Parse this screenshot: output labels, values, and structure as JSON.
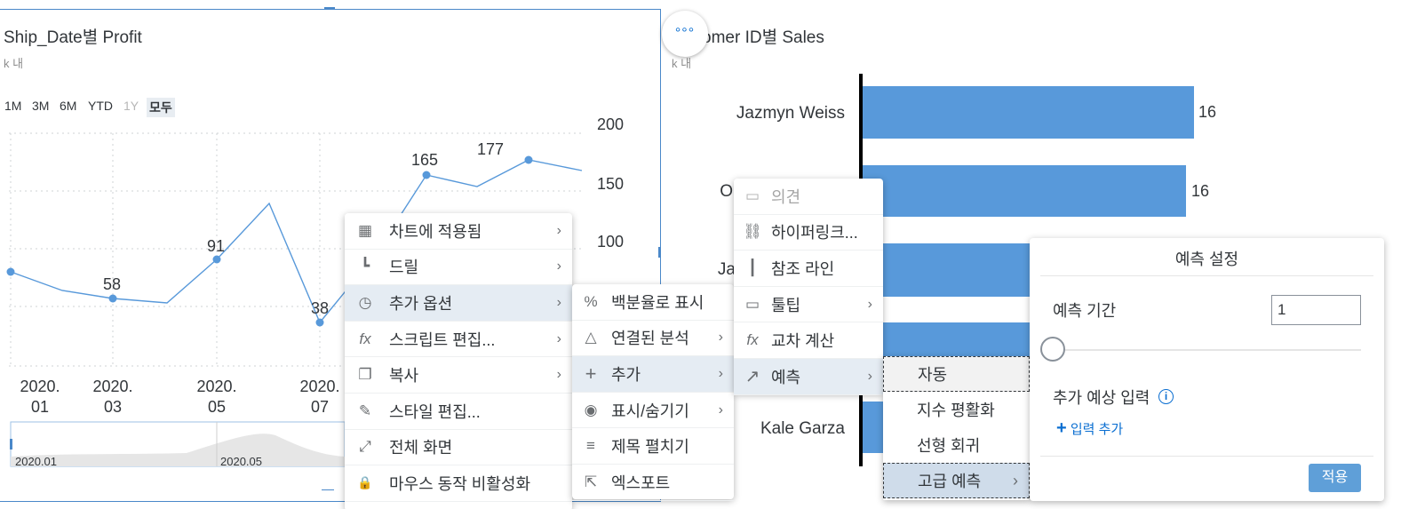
{
  "left_chart": {
    "title": "Ship_Date별 Profit",
    "subtitle": "k 내",
    "range_buttons": [
      "1M",
      "3M",
      "6M",
      "YTD",
      "1Y",
      "모두"
    ],
    "y_ticks": [
      "200",
      "150",
      "100"
    ],
    "x_ticks": [
      [
        "2020.",
        "01"
      ],
      [
        "2020.",
        "03"
      ],
      [
        "2020.",
        "05"
      ],
      [
        "2020.",
        "07"
      ]
    ],
    "data_labels": [
      "58",
      "91",
      "38",
      "165",
      "177"
    ],
    "navigator_labels": [
      "2020.01",
      "2020.05"
    ]
  },
  "right_chart": {
    "title": "omer ID별 Sales",
    "subtitle": "k 내",
    "names": [
      "Jazmyn Weiss",
      "O",
      "Ja",
      "Kale Garza"
    ],
    "values": [
      "16",
      "16"
    ]
  },
  "more_button": "°°°",
  "context_menu": {
    "items": [
      {
        "icon": "chart-applied-icon",
        "glyph": "▦",
        "label": "차트에 적용됨",
        "arrow": "›"
      },
      {
        "icon": "drill-icon",
        "glyph": "┗",
        "label": "드릴",
        "arrow": "›"
      },
      {
        "icon": "more-options-icon",
        "glyph": "◷",
        "label": "추가 옵션",
        "arrow": "›"
      },
      {
        "icon": "fx-icon",
        "glyph": "fx",
        "label": "스크립트 편집...",
        "arrow": "›"
      },
      {
        "icon": "copy-icon",
        "glyph": "❐",
        "label": "복사",
        "arrow": "›"
      },
      {
        "icon": "style-brush-icon",
        "glyph": "✎",
        "label": "스타일 편집...",
        "arrow": ""
      },
      {
        "icon": "fullscreen-icon",
        "glyph": "⤢",
        "label": "전체 화면",
        "arrow": ""
      },
      {
        "icon": "lock-icon",
        "glyph": "🔒",
        "label": "마우스 동작 비활성화",
        "arrow": ""
      }
    ]
  },
  "options_menu": {
    "items": [
      {
        "icon": "percent-icon",
        "glyph": "%",
        "label": "백분율로 표시",
        "arrow": ""
      },
      {
        "icon": "linked-analysis-icon",
        "glyph": "△",
        "label": "연결된 분석",
        "arrow": "›"
      },
      {
        "icon": "add-icon",
        "glyph": "+",
        "label": "추가",
        "arrow": "›"
      },
      {
        "icon": "show-hide-icon",
        "glyph": "◉",
        "label": "표시/숨기기",
        "arrow": "›"
      },
      {
        "icon": "title-expand-icon",
        "glyph": "≡",
        "label": "제목 펼치기",
        "arrow": ""
      },
      {
        "icon": "export-icon",
        "glyph": "⇱",
        "label": "엑스포트",
        "arrow": ""
      }
    ]
  },
  "add_menu": {
    "items": [
      {
        "icon": "comment-icon",
        "glyph": "▭",
        "label": "의견",
        "arrow": ""
      },
      {
        "icon": "hyperlink-icon",
        "glyph": "⛓",
        "label": "하이퍼링크...",
        "arrow": ""
      },
      {
        "icon": "reference-line-icon",
        "glyph": "┃",
        "label": "참조 라인",
        "arrow": ""
      },
      {
        "icon": "tooltip-icon",
        "glyph": "▭",
        "label": "툴팁",
        "arrow": "›"
      },
      {
        "icon": "fx-icon",
        "glyph": "fx",
        "label": "교차 계산",
        "arrow": ""
      },
      {
        "icon": "forecast-arrow-icon",
        "glyph": "↗",
        "label": "예측",
        "arrow": "›"
      }
    ]
  },
  "forecast_menu": {
    "items": [
      {
        "label": "자동",
        "arrow": ""
      },
      {
        "label": "지수 평활화",
        "arrow": ""
      },
      {
        "label": "선형 회귀",
        "arrow": ""
      },
      {
        "label": "고급 예측",
        "arrow": "›"
      }
    ]
  },
  "forecast_panel": {
    "title": "예측 설정",
    "period_label": "예측 기간",
    "period_value": "1",
    "extra_label": "추가 예상 입력",
    "add_input": "입력 추가",
    "apply": "적용"
  },
  "colors": {
    "accent": "#0a6ed1",
    "bar": "#5899da",
    "line": "#5899da",
    "apply_button": "#5f9fd8"
  }
}
